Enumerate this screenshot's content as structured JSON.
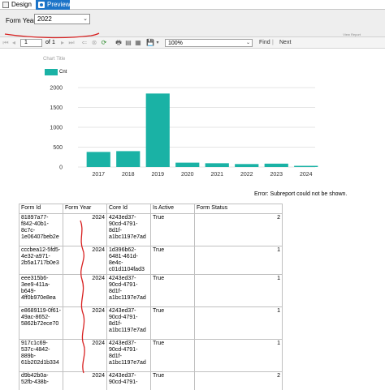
{
  "tabs": [
    {
      "label": "Design"
    },
    {
      "label": "Preview"
    }
  ],
  "parameters": {
    "label": "Form Year",
    "selected": "2022",
    "view_report": "View Report"
  },
  "toolbar": {
    "first": "⏮",
    "prev": "◂",
    "page": "1",
    "of": "of",
    "total": "1",
    "next": "▸",
    "last": "⏭",
    "back": "⇐",
    "stop": "⊗",
    "refresh": "⟳",
    "print": "🖶",
    "layout": "▤",
    "setup": "▦",
    "export": "💾",
    "zoom": "100%",
    "find": "Find",
    "separator": "|",
    "next_label": "Next"
  },
  "chart_data": {
    "type": "bar",
    "title": "Chart Title",
    "legend": "top-left",
    "grid": true,
    "categories": [
      "2017",
      "2018",
      "2019",
      "2020",
      "2021",
      "2022",
      "2023",
      "2024"
    ],
    "series": [
      {
        "name": "Cnt",
        "values": [
          380,
          400,
          1850,
          110,
          95,
          75,
          85,
          30
        ]
      }
    ],
    "ylim": [
      0,
      2000
    ],
    "yticks": [
      "0",
      "500",
      "1000",
      "1500",
      "2000"
    ],
    "color": "#1ab2a5"
  },
  "error": "Error: Subreport could not be shown.",
  "table": {
    "headers": [
      "Form Id",
      "Form Year",
      "Core Id",
      "Is Active",
      "Form Status"
    ],
    "rows": [
      {
        "form_id": "81897a77-f842-40b1-8c7c-1e06407beb2e",
        "year": "2024",
        "core_id": "4243ed37-90cd-4791-8d1f-a1bc1197e7ad",
        "active": "True",
        "status": "2"
      },
      {
        "form_id": "cccbea12-5fd5-4e32-a971-2b5a1717b0e3",
        "year": "2024",
        "core_id": "1d396b62-6481-461d-8e4c-c01d1104fad3",
        "active": "True",
        "status": "1"
      },
      {
        "form_id": "eee315b6-3ee9-411a-b649-4ff0b970e8ea",
        "year": "2024",
        "core_id": "4243ed37-90cd-4791-8d1f-a1bc1197e7ad",
        "active": "True",
        "status": "1"
      },
      {
        "form_id": "e8689119-0f61-49ac-8652-5862b72ece70",
        "year": "2024",
        "core_id": "4243ed37-90cd-4791-8d1f-a1bc1197e7ad",
        "active": "True",
        "status": "1"
      },
      {
        "form_id": "917c1c69-537c-4842-889b-61b202d1b334",
        "year": "2024",
        "core_id": "4243ed37-90cd-4791-8d1f-a1bc1197e7ad",
        "active": "True",
        "status": "1"
      },
      {
        "form_id": "d9b42b0a-52fb-438b-",
        "year": "2024",
        "core_id": "4243ed37-90cd-4791-",
        "active": "True",
        "status": "2"
      }
    ]
  },
  "colors": {
    "accent": "#1c74c8",
    "bar": "#1ab2a5",
    "annotation": "#d82020"
  }
}
